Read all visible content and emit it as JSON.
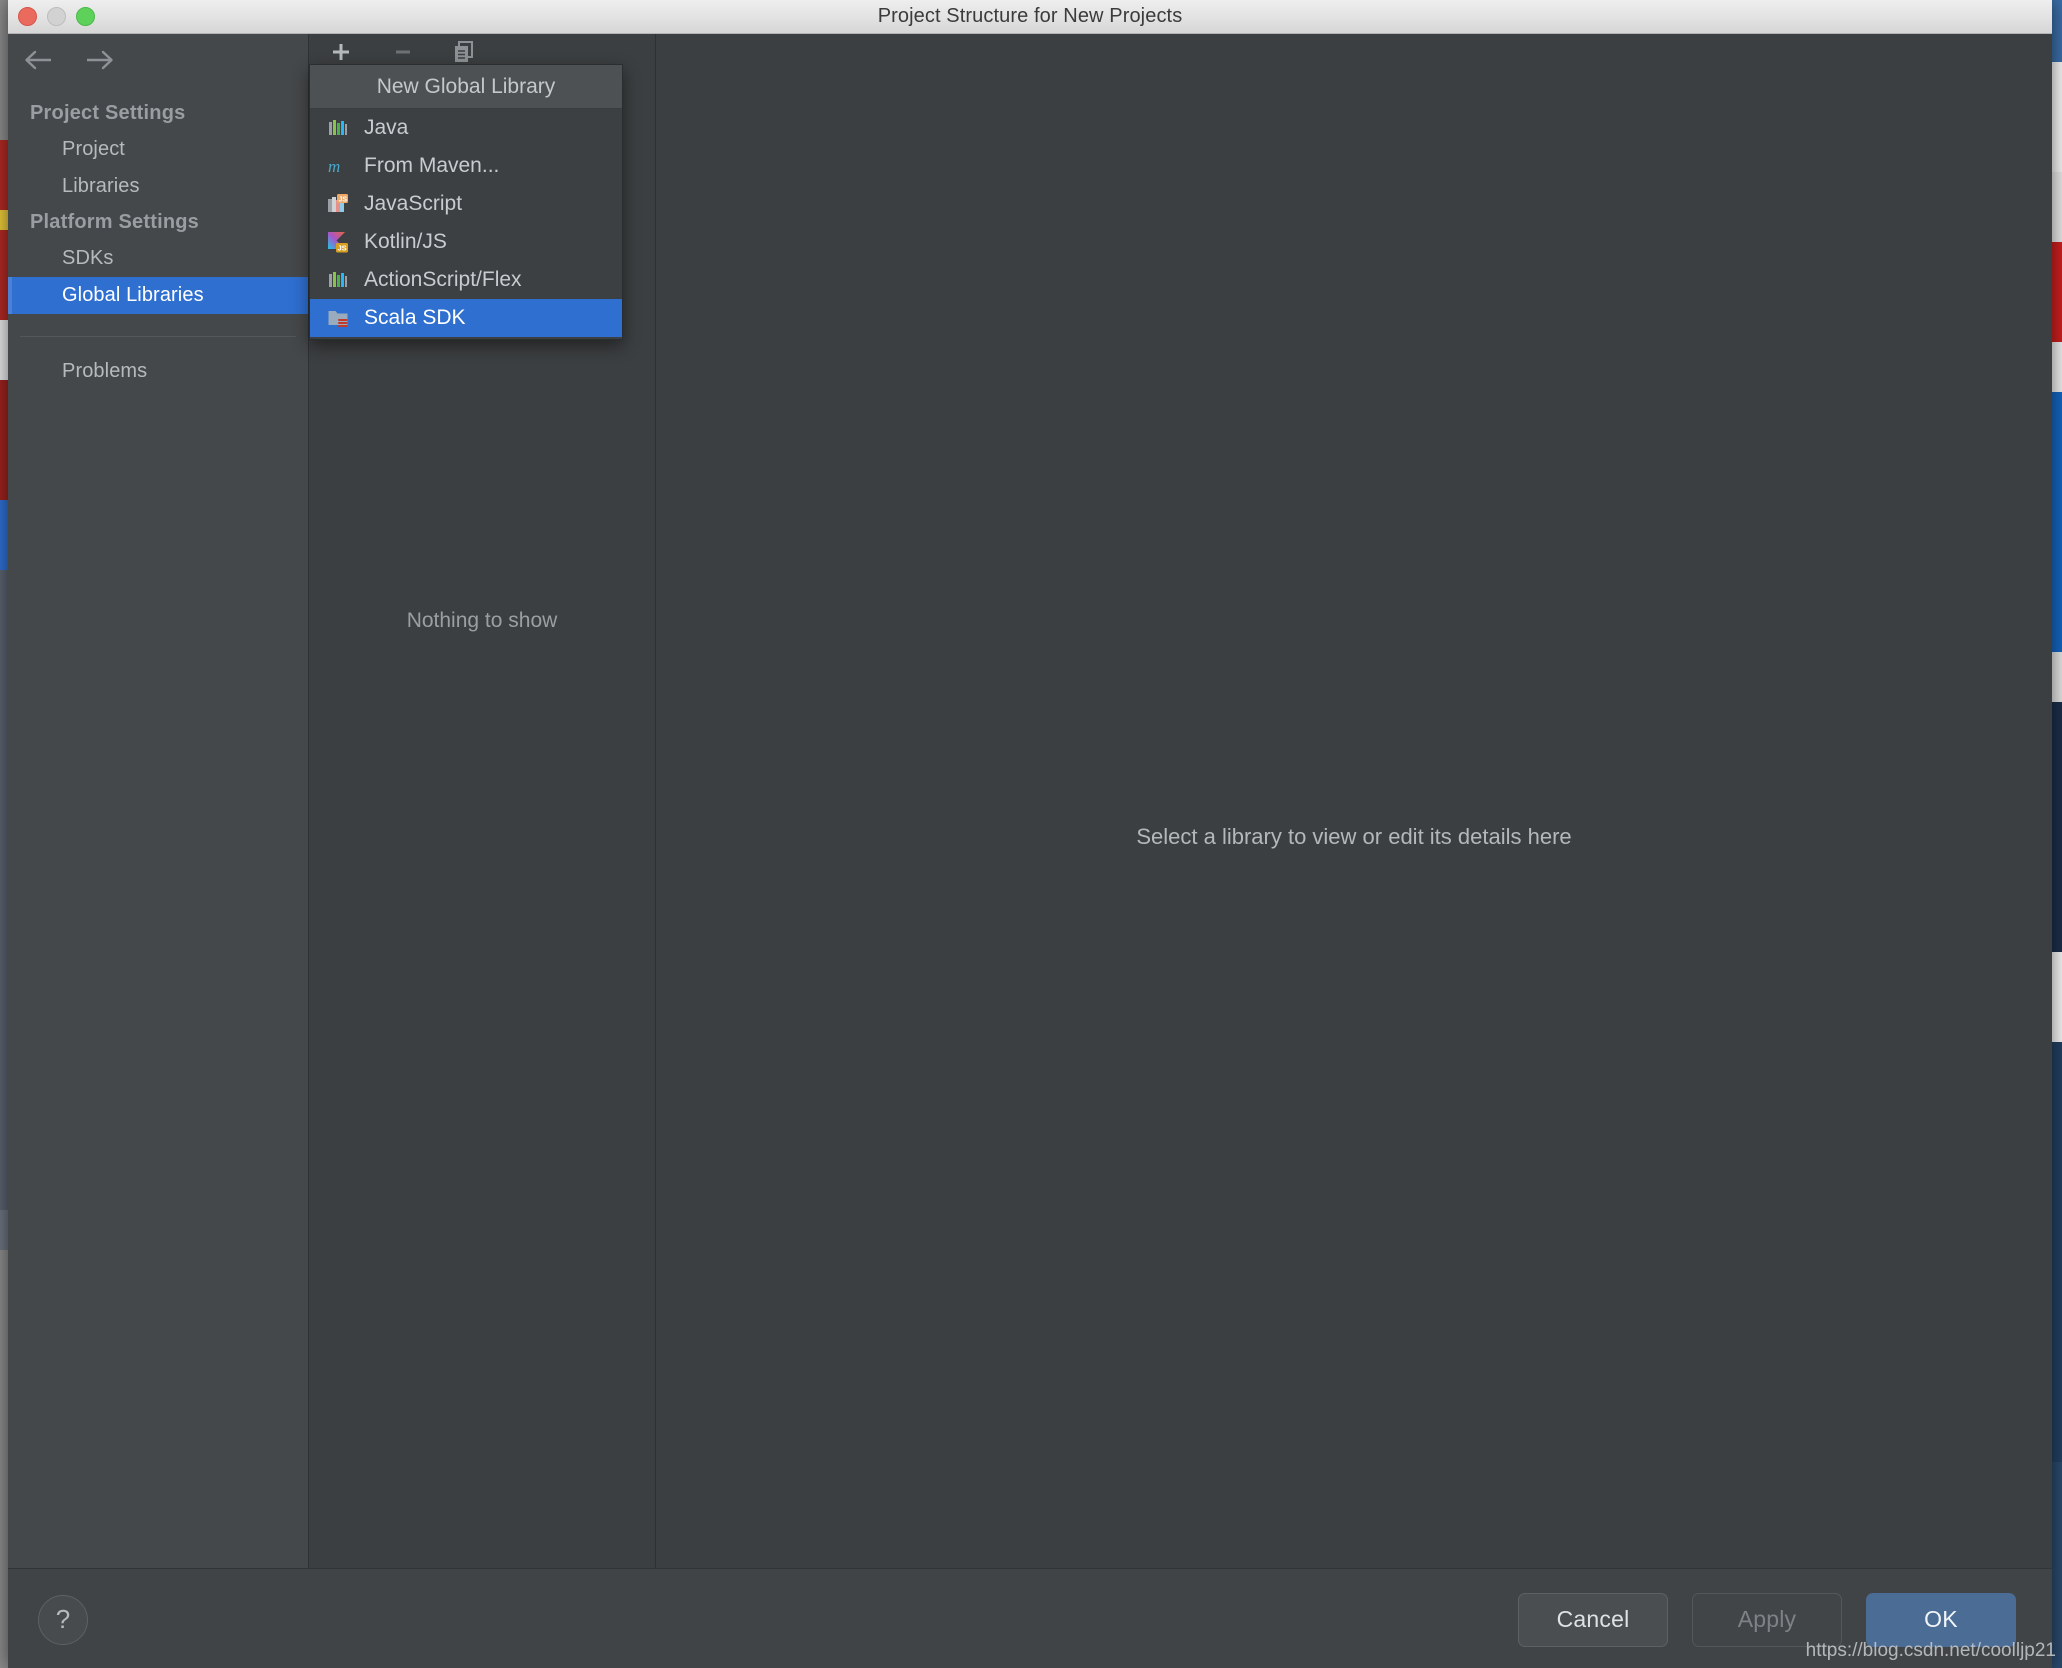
{
  "window": {
    "title": "Project Structure for New Projects",
    "traffic_lights": [
      "close",
      "minimize",
      "maximize"
    ]
  },
  "colors": {
    "accent_blue": "#2f6fd0",
    "ok_button_blue": "#4a6c95",
    "panel_bg": "#3c3f41",
    "sidebar_bg": "#45484a",
    "menu_bg": "#3c4043",
    "menu_header_bg": "#4e5154",
    "titlebar_bg": "#e2e2e2"
  },
  "nav": {
    "back_icon": "arrow-left-icon",
    "forward_icon": "arrow-right-icon",
    "groups": [
      {
        "title": "Project Settings",
        "items": [
          {
            "label": "Project",
            "selected": false
          },
          {
            "label": "Libraries",
            "selected": false
          }
        ]
      },
      {
        "title": "Platform Settings",
        "items": [
          {
            "label": "SDKs",
            "selected": false
          },
          {
            "label": "Global Libraries",
            "selected": true
          }
        ]
      }
    ],
    "extra_items": [
      {
        "label": "Problems",
        "selected": false
      }
    ]
  },
  "libraries_panel": {
    "toolbar": [
      {
        "name": "add-button",
        "icon": "plus-icon",
        "enabled": true
      },
      {
        "name": "remove-button",
        "icon": "minus-icon",
        "enabled": false
      },
      {
        "name": "copy-button",
        "icon": "copy-icon",
        "enabled": true
      }
    ],
    "empty_text": "Nothing to show"
  },
  "new_library_menu": {
    "header": "New Global Library",
    "items": [
      {
        "label": "Java",
        "icon": "java-library-icon",
        "selected": false
      },
      {
        "label": "From Maven...",
        "icon": "maven-icon",
        "selected": false
      },
      {
        "label": "JavaScript",
        "icon": "javascript-library-icon",
        "selected": false
      },
      {
        "label": "Kotlin/JS",
        "icon": "kotlin-js-icon",
        "selected": false
      },
      {
        "label": "ActionScript/Flex",
        "icon": "actionscript-library-icon",
        "selected": false
      },
      {
        "label": "Scala SDK",
        "icon": "scala-sdk-icon",
        "selected": true
      }
    ]
  },
  "detail_panel": {
    "empty_text": "Select a library to view or edit its details here"
  },
  "bottom_bar": {
    "help_label": "?",
    "buttons": [
      {
        "label": "Cancel",
        "name": "cancel-button",
        "enabled": true
      },
      {
        "label": "Apply",
        "name": "apply-button",
        "enabled": false
      },
      {
        "label": "OK",
        "name": "ok-button",
        "enabled": true,
        "primary": true
      }
    ]
  },
  "watermark": {
    "text": "https://blog.csdn.net/coolljp21"
  }
}
